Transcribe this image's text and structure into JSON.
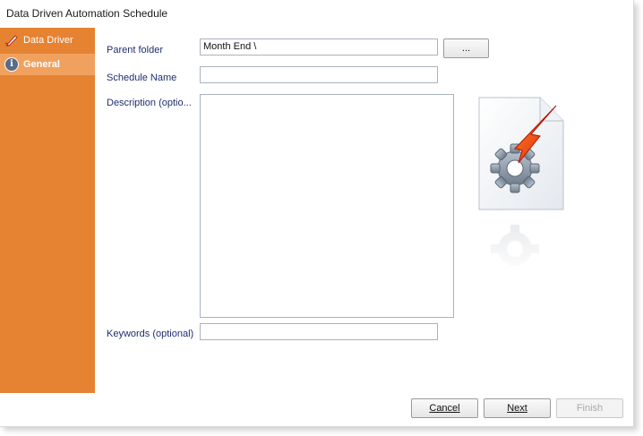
{
  "window": {
    "title": "Data Driven Automation Schedule"
  },
  "sidebar": {
    "items": [
      {
        "label": "Data Driver",
        "icon": "pen-icon",
        "selected": false
      },
      {
        "label": "General",
        "icon": "info-icon",
        "selected": true
      }
    ],
    "scroll_icon": "chevron-down-icon"
  },
  "form": {
    "parent_folder_label": "Parent folder",
    "parent_folder_value": "Month End \\",
    "browse_label": "...",
    "schedule_name_label": "Schedule Name",
    "schedule_name_value": "",
    "description_label": "Description (optio...",
    "description_value": "",
    "keywords_label": "Keywords (optional)",
    "keywords_value": ""
  },
  "buttons": {
    "cancel": {
      "label": "Cancel",
      "enabled": true
    },
    "next": {
      "label": "Next",
      "enabled": true
    },
    "finish": {
      "label": "Finish",
      "enabled": false
    }
  },
  "colors": {
    "sidebar": "#e58333",
    "sidebar_selected": "#f1a15e",
    "label_text": "#1f2f6e"
  }
}
